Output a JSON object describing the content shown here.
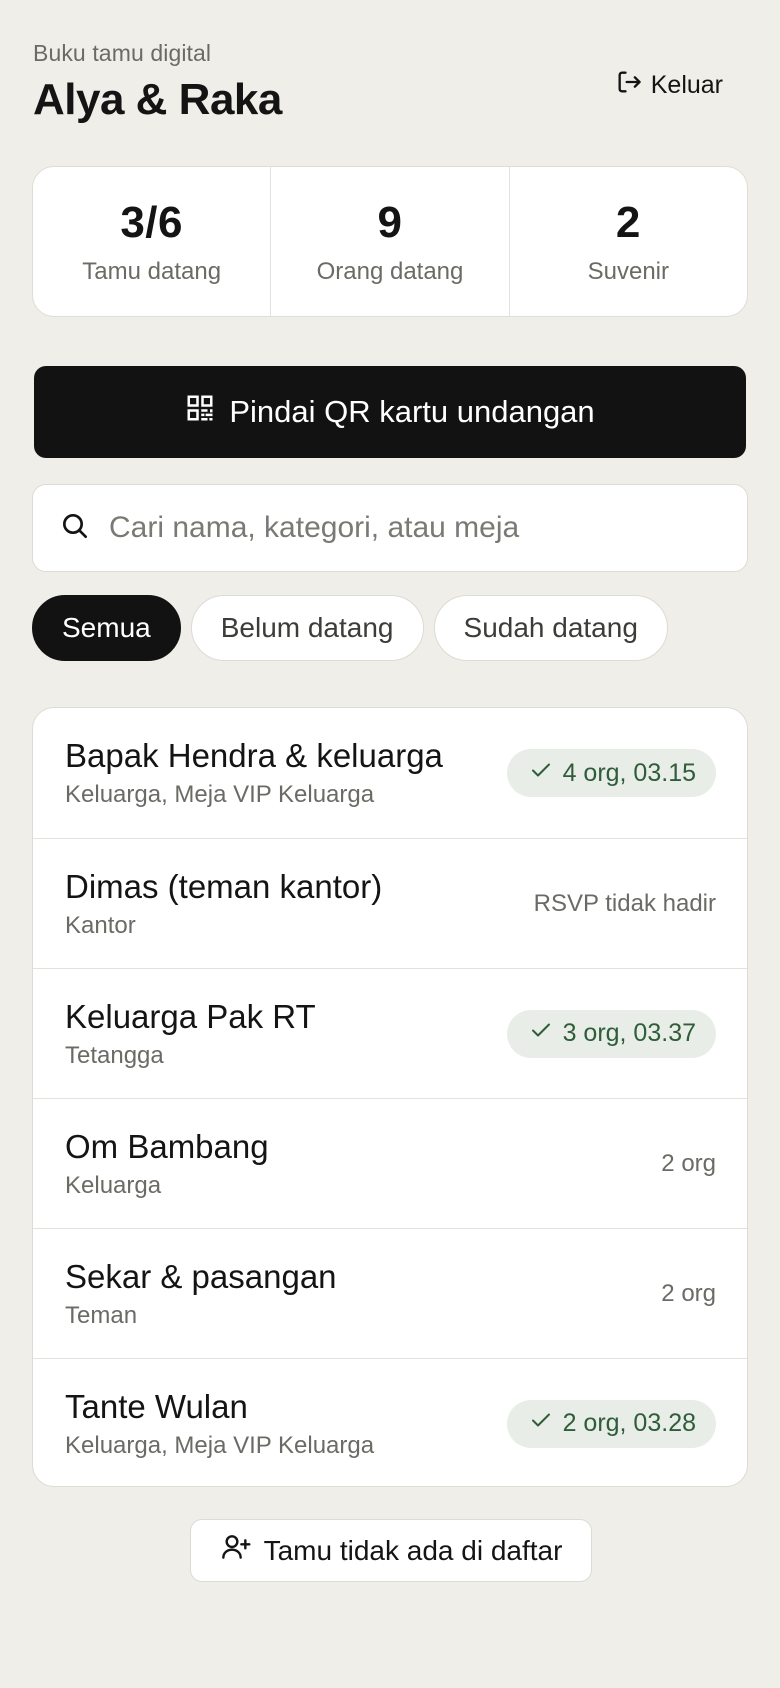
{
  "header": {
    "eyebrow": "Buku tamu digital",
    "title": "Alya & Raka",
    "logout_label": "Keluar"
  },
  "stats": [
    {
      "value": "3/6",
      "label": "Tamu datang"
    },
    {
      "value": "9",
      "label": "Orang datang"
    },
    {
      "value": "2",
      "label": "Suvenir"
    }
  ],
  "scan_button": {
    "label": "Pindai QR kartu undangan",
    "icon": "qr-code-icon"
  },
  "search": {
    "placeholder": "Cari nama, kategori, atau meja",
    "value": "",
    "icon": "search-icon"
  },
  "filters": [
    {
      "label": "Semua",
      "active": true
    },
    {
      "label": "Belum datang",
      "active": false
    },
    {
      "label": "Sudah datang",
      "active": false
    }
  ],
  "guests": [
    {
      "name": "Bapak Hendra & keluarga",
      "sub": "Keluarga, Meja VIP Keluarga",
      "status": "checked-in",
      "right": "4 org, 03.15"
    },
    {
      "name": "Dimas (teman kantor)",
      "sub": "Kantor",
      "status": "declined",
      "right": "RSVP tidak hadir"
    },
    {
      "name": "Keluarga Pak RT",
      "sub": "Tetangga",
      "status": "checked-in",
      "right": "3 org, 03.37"
    },
    {
      "name": "Om Bambang",
      "sub": "Keluarga",
      "status": "pending",
      "right": "2 org"
    },
    {
      "name": "Sekar & pasangan",
      "sub": "Teman",
      "status": "pending",
      "right": "2 org"
    },
    {
      "name": "Tante Wulan",
      "sub": "Keluarga, Meja VIP Keluarga",
      "status": "checked-in",
      "right": "2 org, 03.28"
    }
  ],
  "add_guest_button": {
    "label": "Tamu tidak ada di daftar",
    "icon": "add-user-icon"
  },
  "colors": {
    "background": "#efeee8",
    "primary": "#121212",
    "badge_bg": "#e8ede7",
    "badge_text": "#2f5d3a"
  }
}
